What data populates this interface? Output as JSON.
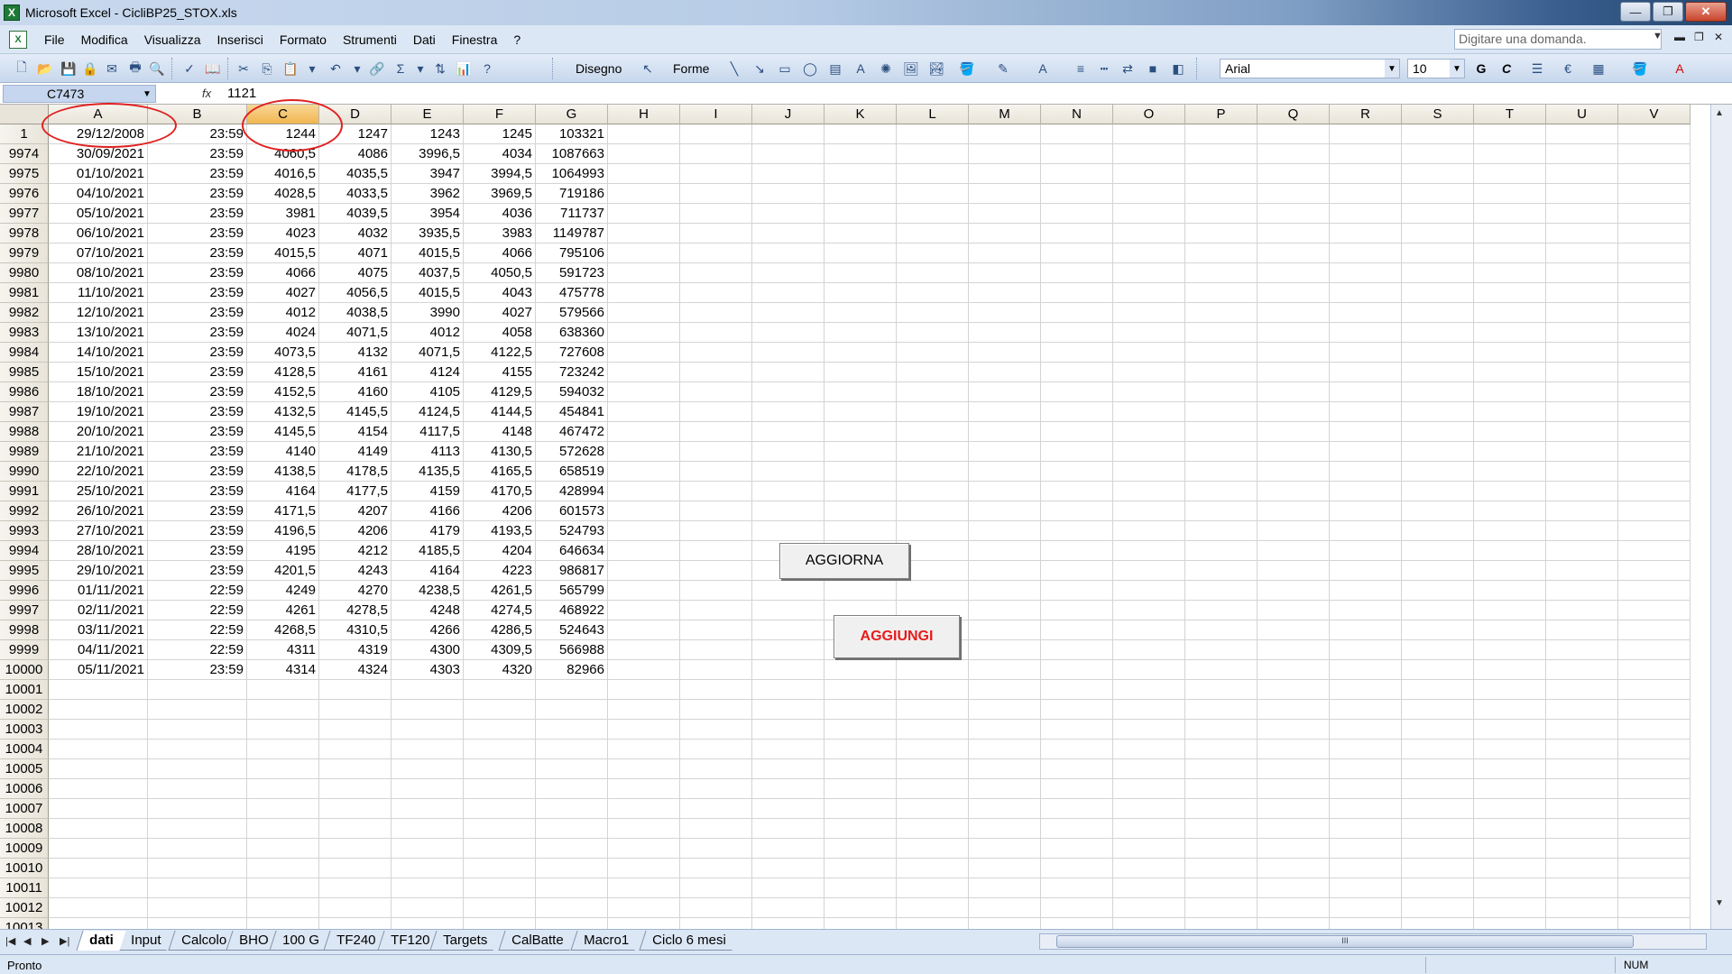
{
  "window": {
    "title": "Microsoft Excel - CicliBP25_STOX.xls",
    "minimize": "—",
    "restore": "❐",
    "close": "✕"
  },
  "menu": {
    "items": [
      "File",
      "Modifica",
      "Visualizza",
      "Inserisci",
      "Formato",
      "Strumenti",
      "Dati",
      "Finestra",
      "?"
    ],
    "help_placeholder": "Digitare una domanda.",
    "window_controls": [
      "▾",
      "🗕",
      "🗗",
      "✕"
    ]
  },
  "toolbar": {
    "draw_label": "Disegno",
    "shapes_label": "Forme",
    "font_name": "Arial",
    "font_size": "10",
    "bold": "G",
    "italic": "C"
  },
  "formula_bar": {
    "name_box": "C7473",
    "fx": "fx",
    "value": "1121"
  },
  "grid": {
    "columns": [
      "A",
      "B",
      "C",
      "D",
      "E",
      "F",
      "G",
      "H",
      "I",
      "J",
      "K",
      "L",
      "M",
      "N",
      "O",
      "P",
      "Q",
      "R",
      "S",
      "T",
      "U",
      "V"
    ],
    "selected_column": "C",
    "rows": [
      {
        "row": "1",
        "cells": [
          "29/12/2008",
          "23:59",
          "1244",
          "1247",
          "1243",
          "1245",
          "103321"
        ]
      },
      {
        "row": "9974",
        "cells": [
          "30/09/2021",
          "23:59",
          "4060,5",
          "4086",
          "3996,5",
          "4034",
          "1087663"
        ]
      },
      {
        "row": "9975",
        "cells": [
          "01/10/2021",
          "23:59",
          "4016,5",
          "4035,5",
          "3947",
          "3994,5",
          "1064993"
        ]
      },
      {
        "row": "9976",
        "cells": [
          "04/10/2021",
          "23:59",
          "4028,5",
          "4033,5",
          "3962",
          "3969,5",
          "719186"
        ]
      },
      {
        "row": "9977",
        "cells": [
          "05/10/2021",
          "23:59",
          "3981",
          "4039,5",
          "3954",
          "4036",
          "711737"
        ]
      },
      {
        "row": "9978",
        "cells": [
          "06/10/2021",
          "23:59",
          "4023",
          "4032",
          "3935,5",
          "3983",
          "1149787"
        ]
      },
      {
        "row": "9979",
        "cells": [
          "07/10/2021",
          "23:59",
          "4015,5",
          "4071",
          "4015,5",
          "4066",
          "795106"
        ]
      },
      {
        "row": "9980",
        "cells": [
          "08/10/2021",
          "23:59",
          "4066",
          "4075",
          "4037,5",
          "4050,5",
          "591723"
        ]
      },
      {
        "row": "9981",
        "cells": [
          "11/10/2021",
          "23:59",
          "4027",
          "4056,5",
          "4015,5",
          "4043",
          "475778"
        ]
      },
      {
        "row": "9982",
        "cells": [
          "12/10/2021",
          "23:59",
          "4012",
          "4038,5",
          "3990",
          "4027",
          "579566"
        ]
      },
      {
        "row": "9983",
        "cells": [
          "13/10/2021",
          "23:59",
          "4024",
          "4071,5",
          "4012",
          "4058",
          "638360"
        ]
      },
      {
        "row": "9984",
        "cells": [
          "14/10/2021",
          "23:59",
          "4073,5",
          "4132",
          "4071,5",
          "4122,5",
          "727608"
        ]
      },
      {
        "row": "9985",
        "cells": [
          "15/10/2021",
          "23:59",
          "4128,5",
          "4161",
          "4124",
          "4155",
          "723242"
        ]
      },
      {
        "row": "9986",
        "cells": [
          "18/10/2021",
          "23:59",
          "4152,5",
          "4160",
          "4105",
          "4129,5",
          "594032"
        ]
      },
      {
        "row": "9987",
        "cells": [
          "19/10/2021",
          "23:59",
          "4132,5",
          "4145,5",
          "4124,5",
          "4144,5",
          "454841"
        ]
      },
      {
        "row": "9988",
        "cells": [
          "20/10/2021",
          "23:59",
          "4145,5",
          "4154",
          "4117,5",
          "4148",
          "467472"
        ]
      },
      {
        "row": "9989",
        "cells": [
          "21/10/2021",
          "23:59",
          "4140",
          "4149",
          "4113",
          "4130,5",
          "572628"
        ]
      },
      {
        "row": "9990",
        "cells": [
          "22/10/2021",
          "23:59",
          "4138,5",
          "4178,5",
          "4135,5",
          "4165,5",
          "658519"
        ]
      },
      {
        "row": "9991",
        "cells": [
          "25/10/2021",
          "23:59",
          "4164",
          "4177,5",
          "4159",
          "4170,5",
          "428994"
        ]
      },
      {
        "row": "9992",
        "cells": [
          "26/10/2021",
          "23:59",
          "4171,5",
          "4207",
          "4166",
          "4206",
          "601573"
        ]
      },
      {
        "row": "9993",
        "cells": [
          "27/10/2021",
          "23:59",
          "4196,5",
          "4206",
          "4179",
          "4193,5",
          "524793"
        ]
      },
      {
        "row": "9994",
        "cells": [
          "28/10/2021",
          "23:59",
          "4195",
          "4212",
          "4185,5",
          "4204",
          "646634"
        ]
      },
      {
        "row": "9995",
        "cells": [
          "29/10/2021",
          "23:59",
          "4201,5",
          "4243",
          "4164",
          "4223",
          "986817"
        ]
      },
      {
        "row": "9996",
        "cells": [
          "01/11/2021",
          "22:59",
          "4249",
          "4270",
          "4238,5",
          "4261,5",
          "565799"
        ]
      },
      {
        "row": "9997",
        "cells": [
          "02/11/2021",
          "22:59",
          "4261",
          "4278,5",
          "4248",
          "4274,5",
          "468922"
        ]
      },
      {
        "row": "9998",
        "cells": [
          "03/11/2021",
          "22:59",
          "4268,5",
          "4310,5",
          "4266",
          "4286,5",
          "524643"
        ]
      },
      {
        "row": "9999",
        "cells": [
          "04/11/2021",
          "22:59",
          "4311",
          "4319",
          "4300",
          "4309,5",
          "566988"
        ]
      },
      {
        "row": "10000",
        "cells": [
          "05/11/2021",
          "23:59",
          "4314",
          "4324",
          "4303",
          "4320",
          "82966"
        ]
      },
      {
        "row": "10001",
        "cells": []
      },
      {
        "row": "10002",
        "cells": []
      },
      {
        "row": "10003",
        "cells": []
      },
      {
        "row": "10004",
        "cells": []
      },
      {
        "row": "10005",
        "cells": []
      },
      {
        "row": "10006",
        "cells": []
      },
      {
        "row": "10007",
        "cells": []
      },
      {
        "row": "10008",
        "cells": []
      },
      {
        "row": "10009",
        "cells": []
      },
      {
        "row": "10010",
        "cells": []
      },
      {
        "row": "10011",
        "cells": []
      },
      {
        "row": "10012",
        "cells": []
      },
      {
        "row": "10013",
        "cells": []
      }
    ]
  },
  "buttons": {
    "aggiorna": "AGGIORNA",
    "aggiungi": "AGGIUNGI",
    "aggiungi_color": "#e61c1c"
  },
  "annotation_color": "#e02020",
  "sheet_tabs": {
    "nav": [
      "|◀",
      "◀",
      "▶",
      "▶|"
    ],
    "tabs": [
      "dati",
      "Input",
      "Calcolo",
      "BHO",
      "100 G",
      "TF240",
      "TF120",
      "Targets",
      "CalBatte",
      "Macro1",
      "Ciclo 6 mesi"
    ],
    "active": "dati",
    "hscroll_grip": "III"
  },
  "status": {
    "text": "Pronto",
    "num": "NUM"
  }
}
